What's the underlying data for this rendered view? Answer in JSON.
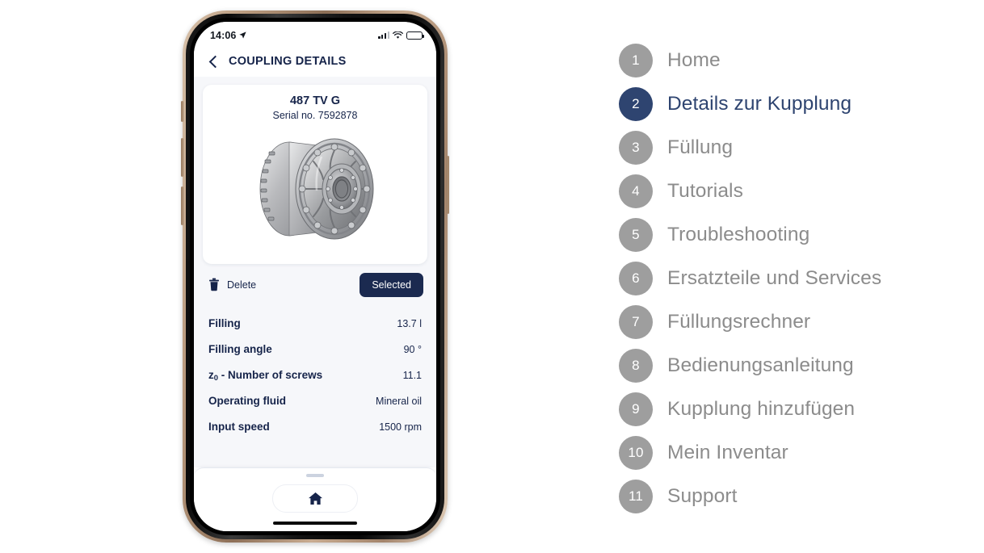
{
  "phone": {
    "status_bar": {
      "time": "14:06",
      "location_icon": "location-arrow-icon",
      "signal_icon": "cellular-signal-icon",
      "wifi_icon": "wifi-icon",
      "battery_icon": "battery-icon"
    },
    "nav": {
      "back_icon": "chevron-left-icon",
      "title": "COUPLING DETAILS"
    },
    "card": {
      "product_name": "487 TV G",
      "serial": "Serial no. 7592878",
      "product_image_alt": "fluid-coupling-3d-render"
    },
    "actions": {
      "delete_icon": "trash-icon",
      "delete_label": "Delete",
      "selected_label": "Selected"
    },
    "specs": [
      {
        "label": "Filling",
        "label_sub": "",
        "label_tail": "",
        "value": "13.7 l"
      },
      {
        "label": "Filling angle",
        "label_sub": "",
        "label_tail": "",
        "value": "90 °"
      },
      {
        "label": "z",
        "label_sub": "0",
        "label_tail": " - Number of screws",
        "value": "11.1"
      },
      {
        "label": "Operating fluid",
        "label_sub": "",
        "label_tail": "",
        "value": "Mineral oil"
      },
      {
        "label": "Input speed",
        "label_sub": "",
        "label_tail": "",
        "value": "1500 rpm"
      }
    ],
    "bottom_bar": {
      "drag_handle": "drag-handle",
      "home_icon": "home-icon"
    }
  },
  "steps": {
    "active_index": 2,
    "items": [
      {
        "number": "1",
        "label": "Home"
      },
      {
        "number": "2",
        "label": "Details zur Kupplung"
      },
      {
        "number": "3",
        "label": "Füllung"
      },
      {
        "number": "4",
        "label": "Tutorials"
      },
      {
        "number": "5",
        "label": "Troubleshooting"
      },
      {
        "number": "6",
        "label": "Ersatzteile und Services"
      },
      {
        "number": "7",
        "label": "Füllungsrechner"
      },
      {
        "number": "8",
        "label": "Bedienungsanleitung"
      },
      {
        "number": "9",
        "label": "Kupplung hinzufügen"
      },
      {
        "number": "10",
        "label": "Mein Inventar"
      },
      {
        "number": "11",
        "label": "Support"
      }
    ]
  },
  "colors": {
    "brand_navy": "#16244a",
    "badge_active": "#2e4470",
    "badge_inactive": "#9e9e9e",
    "label_inactive": "#8c8c8c",
    "button_navy": "#1b2a50",
    "app_background": "#f6f7fa"
  }
}
